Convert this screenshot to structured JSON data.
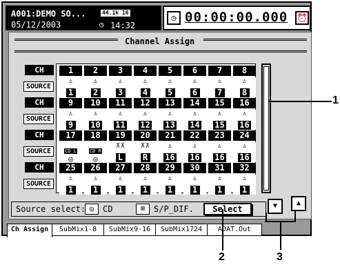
{
  "header": {
    "song_title": "A001:DEMO SO...",
    "fs_badge": "44.1k 16",
    "date": "05/12/2003",
    "clock_time": "14:32",
    "clock_icon": "clock-icon",
    "timer_icon": "timer-icon",
    "counter": "00:00:00.000",
    "alarm_icon": "alarm-icon"
  },
  "panel": {
    "title": "Channel Assign"
  },
  "grid": {
    "ch_label": "CH",
    "source_label": "SOURCE",
    "rows": [
      {
        "channels": [
          "1",
          "2",
          "3",
          "4",
          "5",
          "6",
          "7",
          "8"
        ],
        "sources": [
          {
            "type": "input",
            "value": "1"
          },
          {
            "type": "input",
            "value": "2"
          },
          {
            "type": "input",
            "value": "3"
          },
          {
            "type": "input",
            "value": "4"
          },
          {
            "type": "input",
            "value": "5"
          },
          {
            "type": "input",
            "value": "6"
          },
          {
            "type": "input",
            "value": "7"
          },
          {
            "type": "input",
            "value": "8"
          }
        ]
      },
      {
        "channels": [
          "9",
          "10",
          "11",
          "12",
          "13",
          "14",
          "15",
          "16"
        ],
        "sources": [
          {
            "type": "input",
            "value": "9"
          },
          {
            "type": "input",
            "value": "10"
          },
          {
            "type": "input",
            "value": "11"
          },
          {
            "type": "input",
            "value": "12"
          },
          {
            "type": "input",
            "value": "13"
          },
          {
            "type": "input",
            "value": "14"
          },
          {
            "type": "input",
            "value": "15"
          },
          {
            "type": "input",
            "value": "16"
          }
        ]
      },
      {
        "channels": [
          "17",
          "18",
          "19",
          "20",
          "21",
          "22",
          "23",
          "24"
        ],
        "sources": [
          {
            "type": "cd",
            "value": "CD L"
          },
          {
            "type": "cd",
            "value": "CD R"
          },
          {
            "type": "drum",
            "value": "L"
          },
          {
            "type": "drum",
            "value": "R"
          },
          {
            "type": "input",
            "value": "16"
          },
          {
            "type": "input",
            "value": "16"
          },
          {
            "type": "input",
            "value": "16"
          },
          {
            "type": "input",
            "value": "16"
          }
        ]
      },
      {
        "channels": [
          "25",
          "26",
          "27",
          "28",
          "29",
          "30",
          "31",
          "32"
        ],
        "sources": [
          {
            "type": "input",
            "value": "1"
          },
          {
            "type": "input",
            "value": "1"
          },
          {
            "type": "input",
            "value": "1"
          },
          {
            "type": "input",
            "value": "1"
          },
          {
            "type": "input",
            "value": "1"
          },
          {
            "type": "input",
            "value": "1"
          },
          {
            "type": "input",
            "value": "1"
          },
          {
            "type": "input",
            "value": "1"
          }
        ]
      }
    ]
  },
  "source_select": {
    "label": "Source select:",
    "cd_icon": "cd-disc-icon",
    "cd_label": "CD",
    "spdif_icon": "spdif-icon",
    "spdif_label": "S/P_DIF.",
    "select_button": "Select"
  },
  "tabs": [
    "Ch Assign",
    "SubMix1-8",
    "SubMix9-16",
    "SubMix1724",
    "ADAT.Out"
  ],
  "active_tab": "Ch Assign",
  "callouts": [
    "1",
    "2",
    "3"
  ]
}
